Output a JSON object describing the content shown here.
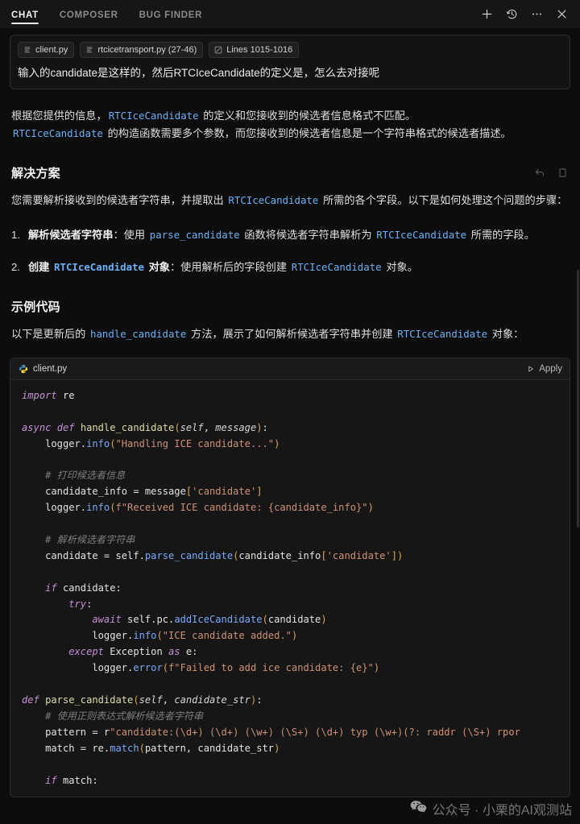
{
  "header": {
    "tabs": [
      {
        "label": "CHAT",
        "active": true
      },
      {
        "label": "COMPOSER",
        "active": false
      },
      {
        "label": "BUG FINDER",
        "active": false
      }
    ],
    "actions": [
      {
        "name": "new-chat-button",
        "label": "+"
      },
      {
        "name": "history-button",
        "label": "History"
      },
      {
        "name": "more-options-button",
        "label": "More"
      },
      {
        "name": "close-button",
        "label": "Close"
      }
    ]
  },
  "prompt": {
    "chips": [
      {
        "icon": "file-icon",
        "label": "client.py"
      },
      {
        "icon": "file-icon",
        "label": "rtcicetransport.py (27-46)"
      },
      {
        "icon": "lines-icon",
        "label": "Lines 1015-1016"
      }
    ],
    "text": "输入的candidate是这样的，然后RTCIceCandidate的定义是，怎么去对接呢"
  },
  "message": {
    "intro_line1_a": "根据您提供的信息，",
    "intro_code1": "RTCIceCandidate",
    "intro_line1_b": " 的定义和您接收到的候选者信息格式不匹配。",
    "intro_code2": "RTCIceCandidate",
    "intro_line2_b": " 的构造函数需要多个参数，而您接收到的候选者信息是一个字符串格式的候选者描述。",
    "actions": [
      {
        "name": "revert-icon",
        "label": "Revert"
      },
      {
        "name": "copy-icon",
        "label": "Copy"
      }
    ],
    "section1_title": "解决方案",
    "section1_para_a": "您需要解析接收到的候选者字符串，并提取出 ",
    "section1_code": "RTCIceCandidate",
    "section1_para_b": " 所需的各个字段。以下是如何处理这个问题的步骤：",
    "steps": [
      {
        "num": "1.",
        "bold_a": "解析候选者字符串",
        "bold_code": "",
        "bold_b": "",
        "rest_a": "：使用 ",
        "code1": "parse_candidate",
        "rest_b": " 函数将候选者字符串解析为 ",
        "code2": "RTCIceCandidate",
        "rest_c": " 所需的字段。"
      },
      {
        "num": "2.",
        "bold_a": "创建 ",
        "bold_code": "RTCIceCandidate",
        "bold_b": " 对象",
        "rest_a": "：使用解析后的字段创建 ",
        "code1": "RTCIceCandidate",
        "rest_b": " 对象。",
        "code2": "",
        "rest_c": ""
      }
    ],
    "section2_title": "示例代码",
    "section2_para_a": "以下是更新后的 ",
    "section2_code1": "handle_candidate",
    "section2_para_b": " 方法，展示了如何解析候选者字符串并创建 ",
    "section2_code2": "RTCIceCandidate",
    "section2_para_c": " 对象："
  },
  "codeblock": {
    "filename": "client.py",
    "file_icon": "python-icon",
    "apply_label": "Apply",
    "apply_icon": "play-icon",
    "language": "python",
    "code_lines": [
      "import re",
      "",
      "async def handle_candidate(self, message):",
      "    logger.info(\"Handling ICE candidate...\")",
      "",
      "    # 打印候选者信息",
      "    candidate_info = message['candidate']",
      "    logger.info(f\"Received ICE candidate: {candidate_info}\")",
      "",
      "    # 解析候选者字符串",
      "    candidate = self.parse_candidate(candidate_info['candidate'])",
      "",
      "    if candidate:",
      "        try:",
      "            await self.pc.addIceCandidate(candidate)",
      "            logger.info(\"ICE candidate added.\")",
      "        except Exception as e:",
      "            logger.error(f\"Failed to add ice candidate: {e}\")",
      "",
      "def parse_candidate(self, candidate_str):",
      "    # 使用正则表达式解析候选者字符串",
      "    pattern = r\"candidate:(\\d+) (\\d+) (\\w+) (\\S+) (\\d+) typ (\\w+)(?: raddr (\\S+) rpor",
      "    match = re.match(pattern, candidate_str)",
      "",
      "    if match:"
    ]
  },
  "watermark": {
    "icon": "wechat-icon",
    "text": "公众号 · 小栗的AI观测站"
  },
  "colors": {
    "background": "#0d0d0d",
    "header_bg": "#161616",
    "code_bg": "#161616",
    "accent_code": "#6cb0f5",
    "text_primary": "#e9e9e9"
  }
}
